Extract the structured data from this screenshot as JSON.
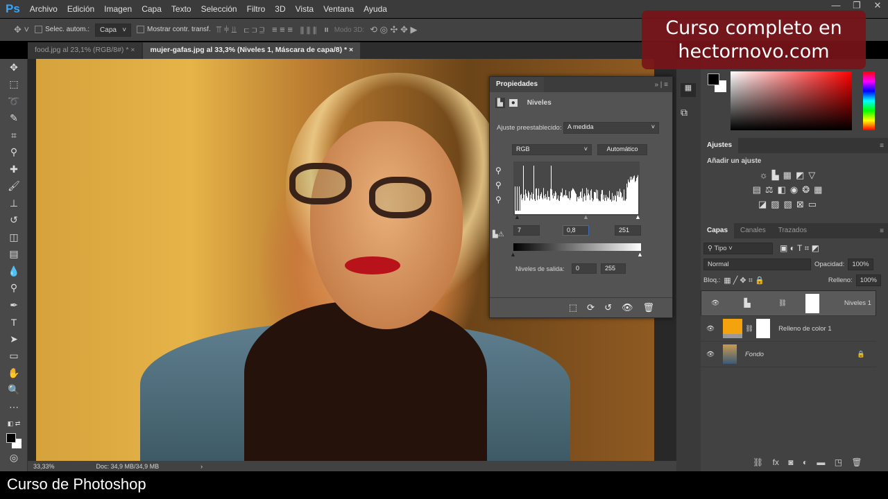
{
  "app": {
    "logo": "Ps",
    "menu": [
      "Archivo",
      "Edición",
      "Imagen",
      "Capa",
      "Texto",
      "Selección",
      "Filtro",
      "3D",
      "Vista",
      "Ventana",
      "Ayuda"
    ],
    "window_controls": [
      "—",
      "❐",
      "✕"
    ]
  },
  "options": {
    "auto_select_label": "Selec. autom.:",
    "auto_select_value": "Capa",
    "show_transform_label": "Mostrar contr. transf.",
    "mode3d_label": "Modo 3D:"
  },
  "tabs": [
    {
      "label": "food.jpg al 23,1% (RGB/8#) *",
      "close": "×"
    },
    {
      "label": "mujer-gafas.jpg al 33,3% (Niveles 1, Máscara de capa/8) *",
      "close": "×"
    }
  ],
  "status": {
    "zoom": "33,33%",
    "doc": "Doc: 34,9 MB/34,9 MB"
  },
  "properties": {
    "title": "Propiedades",
    "adjustment": "Niveles",
    "preset_label": "Ajuste preestablecido:",
    "preset_value": "A medida",
    "channel": "RGB",
    "auto_button": "Automático",
    "input_black": "7",
    "input_gamma": "0,8",
    "input_white": "251",
    "output_label": "Niveles de salida:",
    "output_black": "0",
    "output_white": "255"
  },
  "ajustes": {
    "tab": "Ajustes",
    "add_label": "Añadir un ajuste"
  },
  "layers_panel": {
    "tabs": [
      "Capas",
      "Canales",
      "Trazados"
    ],
    "filter": "Tipo",
    "blend_mode": "Normal",
    "opacity_label": "Opacidad:",
    "opacity": "100%",
    "lock_label": "Bloq.:",
    "fill_label": "Relleno:",
    "fill": "100%",
    "layers": [
      {
        "name": "Niveles 1",
        "selected": true
      },
      {
        "name": "Relleno de color 1",
        "fill_color": "#f4a20e"
      },
      {
        "name": "Fondo",
        "locked": true
      }
    ]
  },
  "overlay": {
    "promo_line1": "Curso completo en",
    "promo_line2": "hectornovo.com",
    "caption": "Curso de Photoshop"
  },
  "colors": {
    "accent": "#31a8ff",
    "promo_bg": "#78141a"
  }
}
